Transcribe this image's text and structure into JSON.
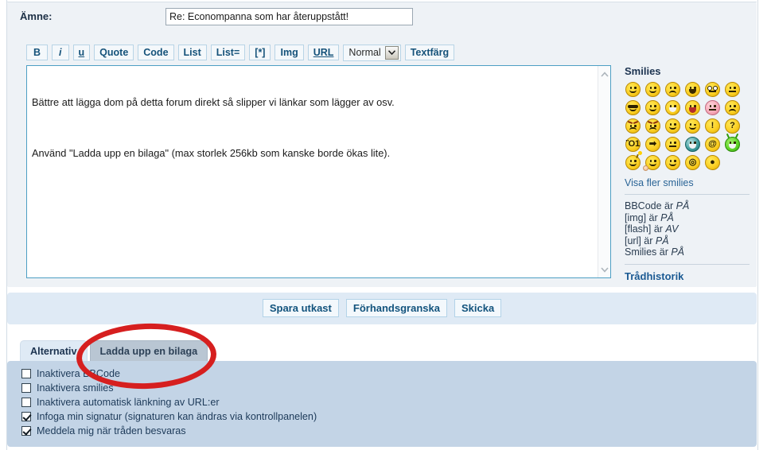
{
  "subject": {
    "label": "Ämne:",
    "value": "Re: Econompanna som har återuppstått!"
  },
  "toolbar": {
    "bold": "B",
    "italic": "i",
    "underline": "u",
    "quote": "Quote",
    "code": "Code",
    "list": "List",
    "list_eq": "List=",
    "list_item": "[*]",
    "img": "Img",
    "url": "URL",
    "font_size_selected": "Normal",
    "text_color": "Textfärg"
  },
  "message": {
    "paragraph_1": "Bättre att lägga dom på detta forum direkt så slipper vi länkar som lägger av osv.",
    "paragraph_2": "Använd \"Ladda upp en bilaga\" (max storlek 256kb som kanske borde ökas lite)."
  },
  "smilies": {
    "title": "Smilies",
    "show_more": "Visa fler smilies",
    "items": [
      {
        "name": "smiley-grin",
        "style": "y",
        "face": "grin"
      },
      {
        "name": "smiley-happy",
        "style": "y",
        "face": "happy"
      },
      {
        "name": "smiley-sad",
        "style": "y",
        "face": "sad"
      },
      {
        "name": "smiley-bigsmile",
        "style": "y",
        "face": "open"
      },
      {
        "name": "smiley-eek",
        "style": "y",
        "face": "glasses"
      },
      {
        "name": "smiley-neutral",
        "style": "y",
        "face": "flat"
      },
      {
        "name": "smiley-cool",
        "style": "y",
        "face": "shades"
      },
      {
        "name": "smiley-mrgreen",
        "style": "y",
        "face": "grin"
      },
      {
        "name": "smiley-grimace",
        "style": "y",
        "face": "grid"
      },
      {
        "name": "smiley-tongue",
        "style": "y",
        "face": "tongue"
      },
      {
        "name": "smiley-blush",
        "style": "pink",
        "face": "flat"
      },
      {
        "name": "smiley-confused",
        "style": "y",
        "face": "sad"
      },
      {
        "name": "smiley-angry",
        "style": "y",
        "face": "angry"
      },
      {
        "name": "smiley-mad",
        "style": "y",
        "face": "angry"
      },
      {
        "name": "smiley-laugh",
        "style": "y",
        "face": "happy"
      },
      {
        "name": "smiley-wink",
        "style": "y",
        "face": "wink"
      },
      {
        "name": "smiley-exclaim",
        "style": "y",
        "face": "sym",
        "symbol": "!"
      },
      {
        "name": "smiley-question",
        "style": "y",
        "face": "sym",
        "symbol": "?"
      },
      {
        "name": "smiley-idea",
        "style": "y",
        "face": "sym",
        "symbol": "Ὂ1"
      },
      {
        "name": "smiley-arrow",
        "style": "y",
        "face": "sym",
        "symbol": "➡"
      },
      {
        "name": "smiley-rolleyes",
        "style": "y",
        "face": "flat"
      },
      {
        "name": "smiley-teeth",
        "style": "teal",
        "face": "grid"
      },
      {
        "name": "smiley-at",
        "style": "y",
        "face": "sym",
        "symbol": "@"
      },
      {
        "name": "smiley-alien",
        "style": "green",
        "face": "grid"
      },
      {
        "name": "smiley-bomb",
        "style": "y",
        "face": "fuse"
      },
      {
        "name": "smiley-wave",
        "style": "y",
        "face": "hand"
      },
      {
        "name": "smiley-biggrin",
        "style": "y",
        "face": "grin"
      },
      {
        "name": "smiley-eyeroll",
        "style": "y",
        "face": "sym",
        "symbol": "◎"
      },
      {
        "name": "smiley-oneeye",
        "style": "y",
        "face": "sym",
        "symbol": "●"
      }
    ],
    "bbcode_info": [
      {
        "tag": "BBCode",
        "word": "är",
        "state": "PÅ"
      },
      {
        "tag": "[img]",
        "word": "är",
        "state": "PÅ"
      },
      {
        "tag": "[flash]",
        "word": "är",
        "state": "AV"
      },
      {
        "tag": "[url]",
        "word": "är",
        "state": "PÅ"
      },
      {
        "tag": "Smilies",
        "word": "är",
        "state": "PÅ"
      }
    ],
    "thread_history": "Trådhistorik"
  },
  "actions": {
    "save_draft": "Spara utkast",
    "preview": "Förhandsgranska",
    "submit": "Skicka"
  },
  "tabs": [
    {
      "label": "Alternativ",
      "active": true
    },
    {
      "label": "Ladda upp en bilaga",
      "active": false
    }
  ],
  "options": [
    {
      "label": "Inaktivera BBCode",
      "checked": false
    },
    {
      "label": "Inaktivera smilies",
      "checked": false
    },
    {
      "label": "Inaktivera automatisk länkning av URL:er",
      "checked": false
    },
    {
      "label": "Infoga min signatur (signaturen kan ändras via kontrollpanelen)",
      "checked": true
    },
    {
      "label": "Meddela mig när tråden besvaras",
      "checked": true
    }
  ],
  "annotation": {
    "shape": "ellipse",
    "color": "#d61f1f",
    "targets": "upload-attachment-tab"
  },
  "colors": {
    "panel_top_bg": "#eef2f6",
    "actions_bg": "#dfeaf5",
    "options_bg": "#c3d4e6",
    "link": "#2a6496",
    "heading": "#1c3350",
    "annotation_red": "#d61f1f"
  }
}
